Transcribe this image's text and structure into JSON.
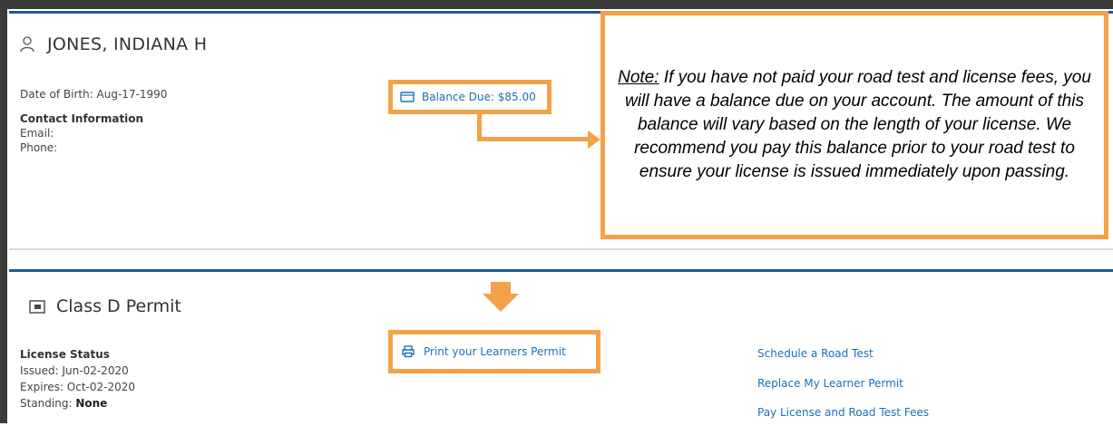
{
  "person": {
    "name": "JONES, INDIANA H",
    "dob": "Date of Birth: Aug-17-1990",
    "contact_title": "Contact Information",
    "email_label": "Email:",
    "phone_label": "Phone:"
  },
  "balance": {
    "label": "Balance Due: $85.00"
  },
  "note": {
    "label": "Note:",
    "text": " If you have not paid your road test and license fees, you will have a balance due on your account. The amount of this balance will vary based on the length of your license. We recommend you pay this balance prior to your road test to ensure your license is issued immediately upon passing."
  },
  "permit": {
    "title": "Class D Permit",
    "print_label": "Print your Learners Permit",
    "status_title": "License Status",
    "issued": "Issued:  Jun-02-2020",
    "expires": "Expires: Oct-02-2020",
    "standing_label": "Standing: ",
    "standing_value": "None"
  },
  "links": {
    "schedule": "Schedule a Road Test",
    "replace": "Replace My Learner Permit",
    "pay": "Pay License and Road Test Fees"
  },
  "colors": {
    "accent_orange": "#f2a34a",
    "link_blue": "#1e6fb8",
    "header_blue": "#1f5a96"
  },
  "icons": [
    "person-icon",
    "card-icon",
    "id-card-icon",
    "printer-icon",
    "arrow-right-icon",
    "arrow-down-icon"
  ]
}
